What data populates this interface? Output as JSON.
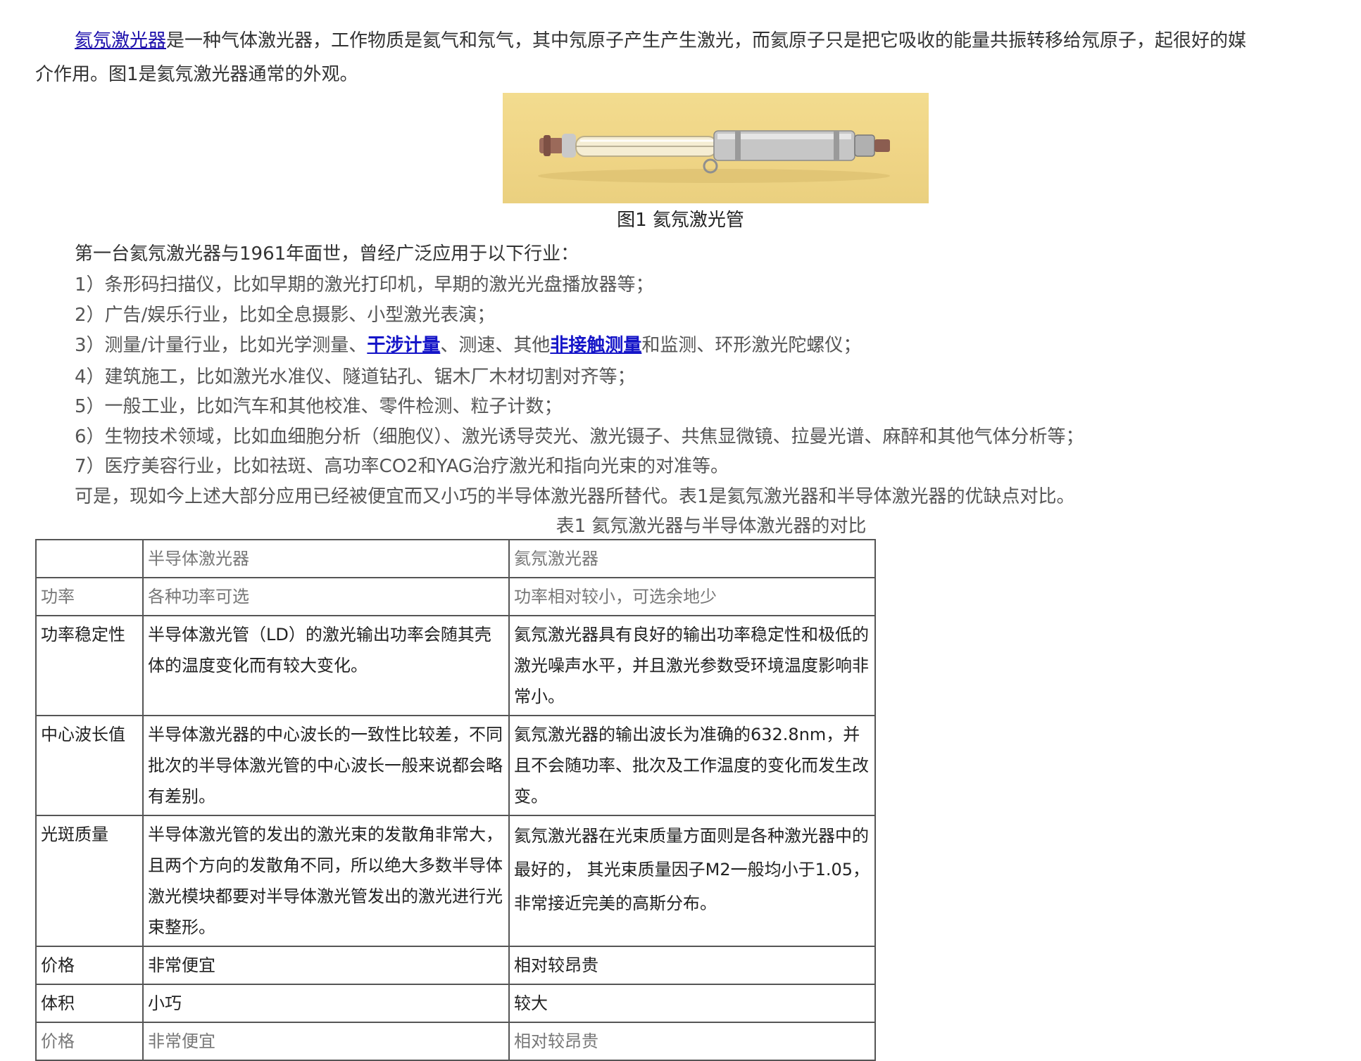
{
  "intro": {
    "link_text": "氦氖激光器",
    "text_rest": "是一种气体激光器，工作物质是氦气和氖气，其中氖原子产生产生激光，而氦原子只是把它吸收的能量共振转移给氖原子，起很好的媒",
    "text_line2": "介作用。图1是氦氖激光器通常的外观。"
  },
  "figure": {
    "image_alt": "氦氖激光管图片",
    "caption": "图1 氦氖激光管"
  },
  "history": {
    "intro": "第一台氦氖激光器与1961年面世，曾经广泛应用于以下行业：",
    "items": [
      "1）条形码扫描仪，比如早期的激光打印机，早期的激光光盘播放器等；",
      "2）广告/娱乐行业，比如全息摄影、小型激光表演；",
      "4）建筑施工，比如激光水准仪、隧道钻孔、锯木厂木材切割对齐等；",
      "5）一般工业，比如汽车和其他校准、零件检测、粒子计数；",
      "6）生物技术领域，比如血细胞分析（细胞仪）、激光诱导荧光、激光镊子、共焦显微镜、拉曼光谱、麻醉和其他气体分析等；",
      "7）医疗美容行业，比如祛斑、高功率CO2和YAG治疗激光和指向光束的对准等。"
    ],
    "item3": {
      "part1": "3）测量/计量行业，比如光学测量、",
      "link1": "干涉计量",
      "part2": "、测速、其他",
      "link2": "非接触测量",
      "part3": "和监测、环形激光陀螺仪；"
    },
    "conclusion": "可是，现如今上述大部分应用已经被便宜而又小巧的半导体激光器所替代。表1是氦氖激光器和半导体激光器的优缺点对比。"
  },
  "table": {
    "caption": "表1 氦氖激光器与半导体激光器的对比",
    "header": [
      "",
      "半导体激光器",
      "氦氖激光器"
    ],
    "rows": [
      [
        "功率",
        "各种功率可选",
        "功率相对较小，可选余地少"
      ],
      [
        "功率稳定性",
        "半导体激光管（LD）的激光输出功率会随其壳体的温度变化而有较大变化。",
        "氦氖激光器具有良好的输出功率稳定性和极低的激光噪声水平，并且激光参数受环境温度影响非常小。"
      ],
      [
        "中心波长值",
        "半导体激光器的中心波长的一致性比较差，不同批次的半导体激光管的中心波长一般来说都会略有差别。",
        "氦氖激光器的输出波长为准确的632.8nm，并且不会随功率、批次及工作温度的变化而发生改变。"
      ],
      [
        "光斑质量",
        "半导体激光管的发出的激光束的发散角非常大，且两个方向的发散角不同，所以绝大多数半导体激光模块都要对半导体激光管发出的激光进行光束整形。",
        "氦氖激光器在光束质量方面则是各种激光器中的最好的， 其光束质量因子M2一般均小于1.05，非常接近完美的高斯分布。"
      ],
      [
        "价格",
        "非常便宜",
        "相对较昂贵"
      ],
      [
        "体积",
        "小巧",
        "较大"
      ],
      [
        "价格",
        "非常便宜",
        "相对较昂贵"
      ]
    ]
  }
}
